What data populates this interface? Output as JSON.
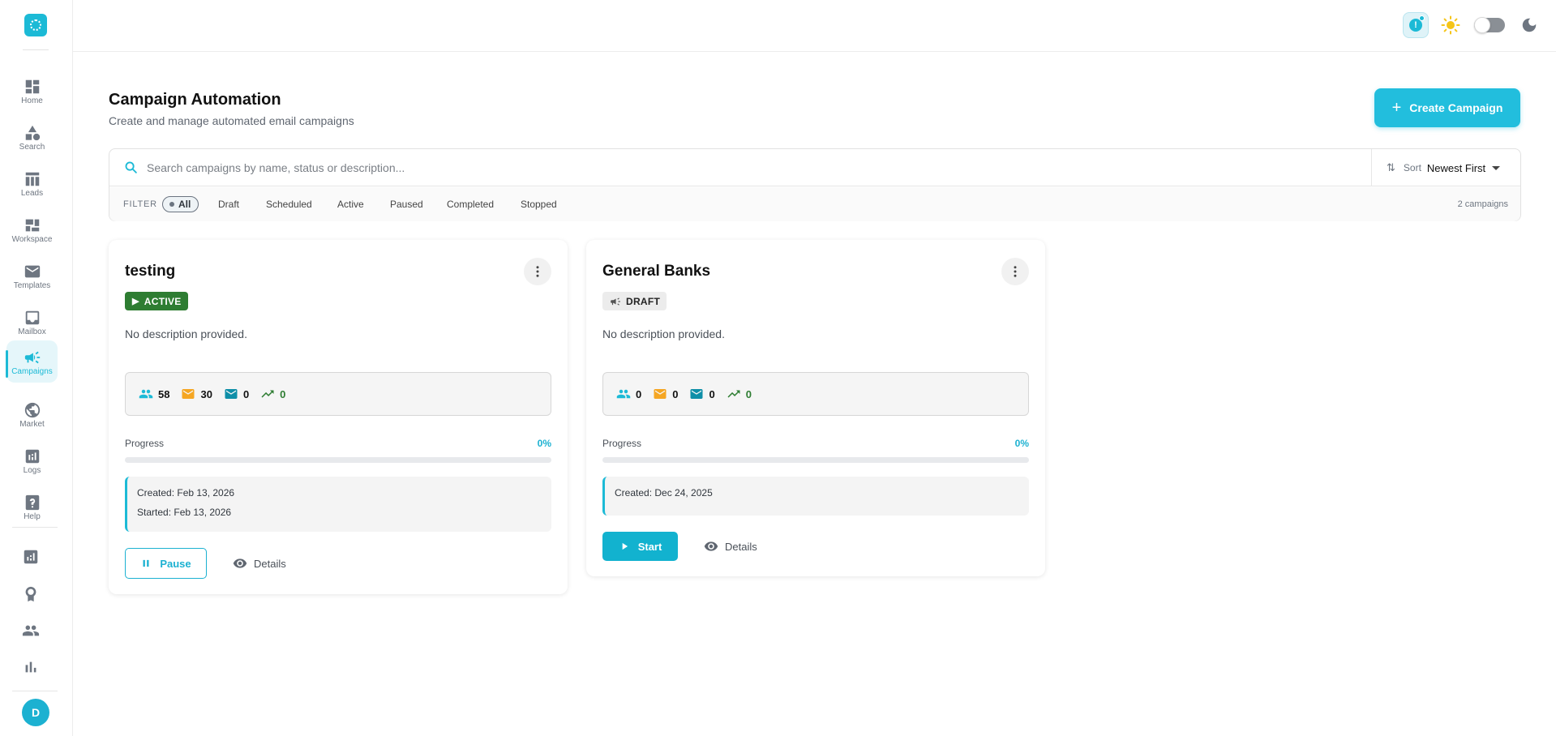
{
  "sidebar": {
    "items": [
      {
        "label": "Home",
        "icon": "dashboard-icon"
      },
      {
        "label": "Search",
        "icon": "category-icon"
      },
      {
        "label": "Leads",
        "icon": "table-icon"
      },
      {
        "label": "Workspace",
        "icon": "workspace-icon"
      },
      {
        "label": "Templates",
        "icon": "mail-icon"
      },
      {
        "label": "Mailbox",
        "icon": "inbox-icon"
      },
      {
        "label": "Campaigns",
        "icon": "megaphone-icon",
        "active": true
      },
      {
        "label": "Market",
        "icon": "globe-icon"
      },
      {
        "label": "Logs",
        "icon": "analytics-icon"
      },
      {
        "label": "Help",
        "icon": "help-icon"
      }
    ],
    "extra_icons": [
      "analytics-box-icon",
      "award-icon",
      "group-icon",
      "bar-chart-icon"
    ],
    "avatar_initial": "D"
  },
  "topbar": {
    "alert_icon": "alert-badge-icon",
    "theme_icons": [
      "sun-icon",
      "moon-icon"
    ]
  },
  "page": {
    "title": "Campaign Automation",
    "subtitle": "Create and manage automated email campaigns",
    "create_button": "Create Campaign"
  },
  "search": {
    "placeholder": "Search campaigns by name, status or description...",
    "sort_label": "Sort",
    "sort_value": "Newest First"
  },
  "filter": {
    "label": "FILTER",
    "chips": [
      "All",
      "Draft",
      "Scheduled",
      "Active",
      "Paused",
      "Completed",
      "Stopped"
    ],
    "active_chip": "All",
    "count_text": "2 campaigns"
  },
  "campaigns": [
    {
      "name": "testing",
      "status": "ACTIVE",
      "description": "No description provided.",
      "stats": {
        "leads": "58",
        "sent": "30",
        "opened": "0",
        "conversions": "0"
      },
      "progress_label": "Progress",
      "progress_text": "0%",
      "progress_fraction": 0,
      "created": "Created: Feb 13, 2026",
      "started": "Started: Feb 13, 2026",
      "primary_action": "Pause",
      "details_label": "Details"
    },
    {
      "name": "General Banks",
      "status": "DRAFT",
      "description": "No description provided.",
      "stats": {
        "leads": "0",
        "sent": "0",
        "opened": "0",
        "conversions": "0"
      },
      "progress_label": "Progress",
      "progress_text": "0%",
      "progress_fraction": 0,
      "created": "Created: Dec 24, 2025",
      "primary_action": "Start",
      "details_label": "Details"
    }
  ],
  "colors": {
    "accent": "#1cbad6",
    "active_badge": "#2e7d32",
    "sent_icon": "#f5a623",
    "opened_icon": "#0f8fa8",
    "conversion": "#2e7d32"
  }
}
